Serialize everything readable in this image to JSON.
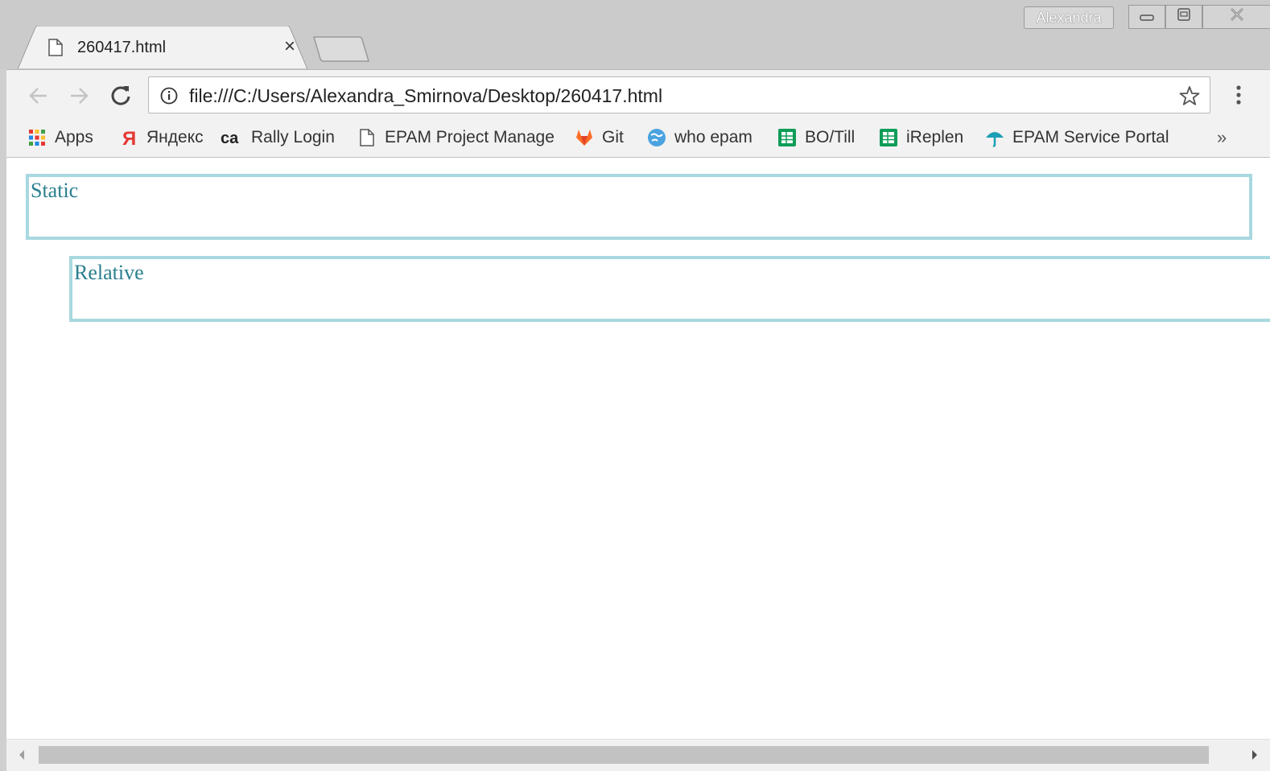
{
  "window": {
    "profile_name": "Alexandra"
  },
  "tab": {
    "title": "260417.html",
    "close_glyph": "×"
  },
  "toolbar": {
    "url": "file:///C:/Users/Alexandra_Smirnova/Desktop/260417.html"
  },
  "bookmarks": {
    "items": [
      {
        "label": "Apps",
        "icon": "apps-grid-icon"
      },
      {
        "label": "Яндекс",
        "icon": "yandex-icon"
      },
      {
        "label": "Rally Login",
        "icon": "ca-icon"
      },
      {
        "label": "EPAM Project Manage",
        "icon": "page-icon"
      },
      {
        "label": "Git",
        "icon": "gitlab-icon"
      },
      {
        "label": "who epam",
        "icon": "globe-icon"
      },
      {
        "label": "BO/Till",
        "icon": "sheet-icon"
      },
      {
        "label": "iReplen",
        "icon": "sheet-icon"
      },
      {
        "label": "EPAM Service Portal",
        "icon": "umbrella-icon"
      }
    ],
    "overflow_glyph": "»"
  },
  "content": {
    "static_label": "Static",
    "relative_label": "Relative"
  },
  "colors": {
    "box_border": "#a8d8e0",
    "box_text": "#2a7f8f"
  }
}
